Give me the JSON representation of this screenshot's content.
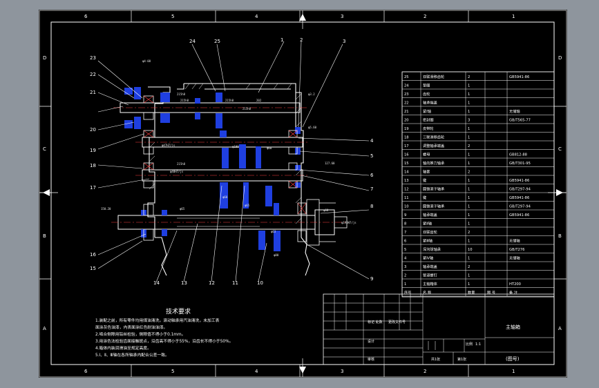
{
  "border_zones": {
    "top": [
      "6",
      "5",
      "4",
      "3",
      "2",
      "1"
    ],
    "left": [
      "D",
      "C",
      "B",
      "A"
    ],
    "right": [
      "D",
      "C",
      "B",
      "A"
    ]
  },
  "callouts": [
    "23",
    "22",
    "21",
    "20",
    "19",
    "18",
    "17",
    "16",
    "15",
    "14",
    "13",
    "12",
    "11",
    "10",
    "9",
    "8",
    "7",
    "6",
    "5",
    "4",
    "3",
    "2",
    "1",
    "24",
    "25"
  ],
  "parts_list": {
    "rows": [
      [
        "25",
        "双联滑移齿轮",
        "2",
        "",
        "GB5941-86"
      ],
      [
        "24",
        "垫圈",
        "1",
        "",
        ""
      ],
      [
        "23",
        "齿轮",
        "1",
        "",
        ""
      ],
      [
        "22",
        "轴承端盖",
        "1",
        "",
        ""
      ],
      [
        "21",
        "紧Ⅰ轴",
        "1",
        "",
        "无储轴"
      ],
      [
        "20",
        "密封圈",
        "3",
        "",
        "GB/T565-77"
      ],
      [
        "19",
        "皮带轮",
        "1",
        "",
        ""
      ],
      [
        "18",
        "三联滑移齿轮",
        "1",
        "",
        ""
      ],
      [
        "17",
        "调整轴承端盖",
        "2",
        "",
        ""
      ],
      [
        "16",
        "螺母",
        "1",
        "",
        "GB812-88"
      ],
      [
        "15",
        "轴向推力轴承",
        "1",
        "",
        "GB/T301-95"
      ],
      [
        "14",
        "轴套",
        "2",
        "",
        ""
      ],
      [
        "13",
        "键",
        "1",
        "",
        "GB5941-86"
      ],
      [
        "12",
        "圆锥滚子轴承",
        "1",
        "",
        "GB/T297-94"
      ],
      [
        "11",
        "键",
        "1",
        "",
        "GB5941-86"
      ],
      [
        "10",
        "圆锥滚子轴承",
        "1",
        "",
        "GB/T297-94"
      ],
      [
        "9",
        "轴承端盖",
        "1",
        "",
        "GB5941-86"
      ],
      [
        "8",
        "紧Ⅱ轴",
        "1",
        "",
        ""
      ],
      [
        "7",
        "双联齿轮",
        "2",
        "",
        ""
      ],
      [
        "6",
        "紧Ⅲ轴",
        "1",
        "",
        "无储轴"
      ],
      [
        "5",
        "深沟球轴承",
        "10",
        "",
        "GB/T276"
      ],
      [
        "4",
        "紧Ⅳ轴",
        "1",
        "",
        "无储轴"
      ],
      [
        "3",
        "轴承端盖",
        "2",
        "",
        ""
      ],
      [
        "2",
        "管道螺钉",
        "1",
        "",
        ""
      ],
      [
        "1",
        "主轴箱体",
        "1",
        "",
        "HT200"
      ]
    ],
    "header": [
      "序号",
      "名  称",
      "数量",
      "图 号",
      "备  注"
    ]
  },
  "tech_requirements": {
    "title": "技术要求",
    "lines": [
      "1.装配之前，所有零件均用煤油清洗，滚动轴承用汽油清洗，未加工表",
      "面涂灰色油漆，内表面涂红色耐油油漆。",
      "2.啮合侧隙用铅丝检验，侧隙值不得小于0.1mm。",
      "3.用涂色法检验齿面接触斑点，沿齿高不得小于55%，沿齿长不得小于50%。",
      "4.箱体内装润滑油至规定高度。",
      "5.Ⅰ、Ⅱ、Ⅲ轴在各所轴承内配合公差一致。"
    ]
  },
  "title_block": {
    "name": "主轴箱",
    "drawing_no": "(图号)",
    "scale_label": "比例",
    "scale_value": "1:1",
    "sheet_label": "共1张",
    "sheet_of": "第1张"
  },
  "colors": {
    "background": "#8e959d",
    "sheet": "#000000",
    "lines": "#ffffff",
    "cut_sections": "#1f3fe0",
    "leaders": "#ffffff"
  }
}
